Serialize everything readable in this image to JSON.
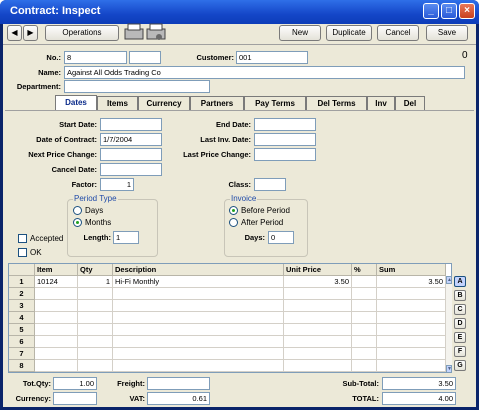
{
  "window": {
    "title": "Contract: Inspect"
  },
  "toolbar": {
    "back_symbol": "◀",
    "forward_symbol": "▶",
    "operations": "Operations",
    "new": "New",
    "duplicate": "Duplicate",
    "cancel": "Cancel",
    "save": "Save",
    "attachment_symbol": "0"
  },
  "header": {
    "no_label": "No.:",
    "no_value": "8",
    "customer_label": "Customer:",
    "customer_value": "001",
    "name_label": "Name:",
    "name_value": "Against All Odds Trading Co",
    "department_label": "Department:",
    "department_value": ""
  },
  "tabs": [
    "Dates",
    "Items",
    "Currency",
    "Partners",
    "Pay Terms",
    "Del Terms",
    "Inv",
    "Del"
  ],
  "dates": {
    "start_date_label": "Start Date:",
    "start_date": "",
    "end_date_label": "End Date:",
    "end_date": "",
    "date_of_contract_label": "Date of Contract:",
    "date_of_contract": "1/7/2004",
    "last_inv_date_label": "Last Inv. Date:",
    "last_inv_date": "",
    "next_price_change_label": "Next Price Change:",
    "next_price_change": "",
    "last_price_change_label": "Last Price Change:",
    "last_price_change": "",
    "cancel_date_label": "Cancel Date:",
    "cancel_date": "",
    "factor_label": "Factor:",
    "factor": "1",
    "class_label": "Class:",
    "class_value": "",
    "period_type_title": "Period Type",
    "days_option": "Days",
    "months_option": "Months",
    "length_label": "Length:",
    "length": "1",
    "invoice_title": "Invoice",
    "before_period_option": "Before Period",
    "after_period_option": "After Period",
    "inv_days_label": "Days:",
    "inv_days": "0",
    "accepted_label": "Accepted",
    "ok_label": "OK"
  },
  "grid": {
    "columns": [
      "Item",
      "Qty",
      "Description",
      "Unit Price",
      "%",
      "Sum"
    ],
    "rows": [
      {
        "num": "1",
        "item": "10124",
        "qty": "1",
        "description": "Hi-Fi Monthly",
        "unit_price": "3.50",
        "pct": "",
        "sum": "3.50"
      },
      {
        "num": "2",
        "item": "",
        "qty": "",
        "description": "",
        "unit_price": "",
        "pct": "",
        "sum": ""
      },
      {
        "num": "3",
        "item": "",
        "qty": "",
        "description": "",
        "unit_price": "",
        "pct": "",
        "sum": ""
      },
      {
        "num": "4",
        "item": "",
        "qty": "",
        "description": "",
        "unit_price": "",
        "pct": "",
        "sum": ""
      },
      {
        "num": "5",
        "item": "",
        "qty": "",
        "description": "",
        "unit_price": "",
        "pct": "",
        "sum": ""
      },
      {
        "num": "6",
        "item": "",
        "qty": "",
        "description": "",
        "unit_price": "",
        "pct": "",
        "sum": ""
      },
      {
        "num": "7",
        "item": "",
        "qty": "",
        "description": "",
        "unit_price": "",
        "pct": "",
        "sum": ""
      },
      {
        "num": "8",
        "item": "",
        "qty": "",
        "description": "",
        "unit_price": "",
        "pct": "",
        "sum": ""
      }
    ],
    "side_buttons": [
      "A",
      "B",
      "C",
      "D",
      "E",
      "F",
      "G"
    ],
    "scroll_up_symbol": "▲",
    "scroll_down_symbol": "▼"
  },
  "footer": {
    "tot_qty_label": "Tot.Qty:",
    "tot_qty": "1.00",
    "freight_label": "Freight:",
    "freight": "",
    "sub_total_label": "Sub-Total:",
    "sub_total": "3.50",
    "currency_label": "Currency:",
    "currency": "",
    "vat_label": "VAT:",
    "vat": "0.61",
    "total_label": "TOTAL:",
    "total": "4.00"
  },
  "colors": {
    "titlebar": "#1446c8",
    "window_bg": "#ece9d8",
    "active_tab_text": "#0a2a8a",
    "group_title": "#1f4aa8"
  }
}
